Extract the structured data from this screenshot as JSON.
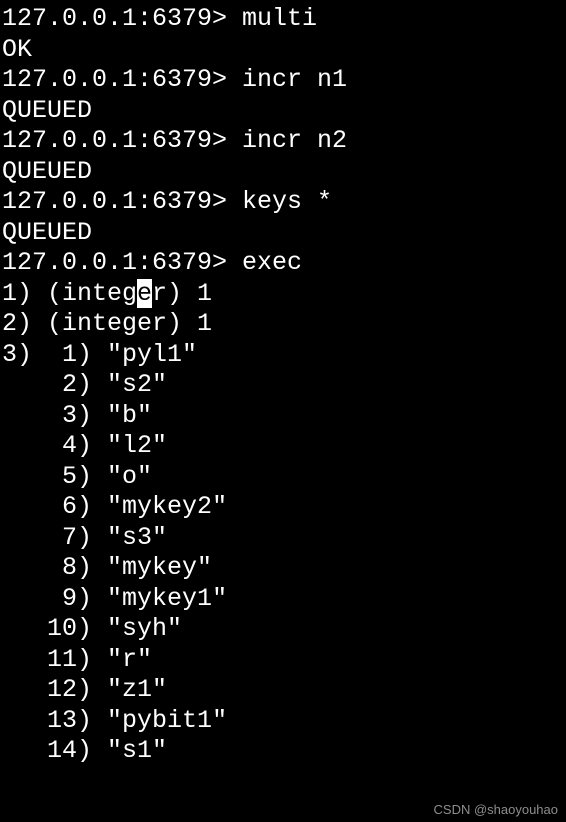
{
  "prompt": "127.0.0.1:6379> ",
  "commands": [
    {
      "cmd": "multi",
      "response": "OK"
    },
    {
      "cmd": "incr n1",
      "response": "QUEUED"
    },
    {
      "cmd": "incr n2",
      "response": "QUEUED"
    },
    {
      "cmd": "keys *",
      "response": "QUEUED"
    },
    {
      "cmd": "exec"
    }
  ],
  "exec_results": {
    "r1_prefix": "1) (integ",
    "r1_highlight": "e",
    "r1_suffix": "r) 1",
    "r2": "2) (integer) 1",
    "r3_prefix": "3)  ",
    "keys": [
      {
        "idx": "1)",
        "val": "\"pyl1\""
      },
      {
        "idx": "2)",
        "val": "\"s2\""
      },
      {
        "idx": "3)",
        "val": "\"b\""
      },
      {
        "idx": "4)",
        "val": "\"l2\""
      },
      {
        "idx": "5)",
        "val": "\"o\""
      },
      {
        "idx": "6)",
        "val": "\"mykey2\""
      },
      {
        "idx": "7)",
        "val": "\"s3\""
      },
      {
        "idx": "8)",
        "val": "\"mykey\""
      },
      {
        "idx": "9)",
        "val": "\"mykey1\""
      },
      {
        "idx": "10)",
        "val": "\"syh\""
      },
      {
        "idx": "11)",
        "val": "\"r\""
      },
      {
        "idx": "12)",
        "val": "\"z1\""
      },
      {
        "idx": "13)",
        "val": "\"pybit1\""
      },
      {
        "idx": "14)",
        "val": "\"s1\""
      }
    ]
  },
  "watermark": "CSDN @shaoyouhao"
}
